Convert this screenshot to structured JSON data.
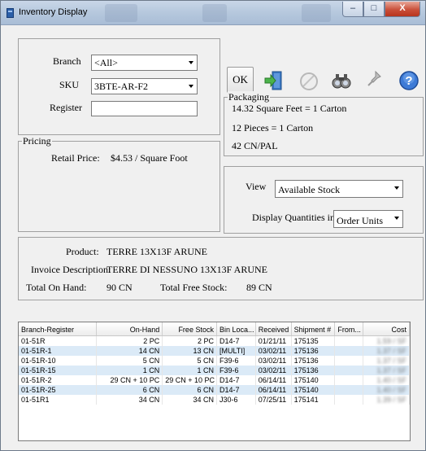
{
  "window": {
    "title": "Inventory Display"
  },
  "filters": {
    "branch_label": "Branch",
    "branch_value": "<All>",
    "sku_label": "SKU",
    "sku_value": "3BTE-AR-F2",
    "register_label": "Register",
    "register_value": ""
  },
  "toolbar": {
    "ok_label": "OK"
  },
  "packaging": {
    "legend": "Packaging",
    "lines": [
      "14.32 Square Feet = 1 Carton",
      "12 Pieces = 1 Carton",
      "42 CN/PAL"
    ]
  },
  "pricing": {
    "legend": "Pricing",
    "retail_label": "Retail Price:",
    "retail_value": "$4.53 / Square Foot"
  },
  "view": {
    "view_label": "View",
    "view_value": "Available Stock",
    "display_label": "Display Quantities in",
    "display_value": "Order Units"
  },
  "product": {
    "product_label": "Product:",
    "product_value": "TERRE 13X13F    ARUNE",
    "invoice_label": "Invoice Description:",
    "invoice_value": "TERRE DI NESSUNO 13X13F ARUNE",
    "onhand_label": "Total On Hand:",
    "onhand_value": "90 CN",
    "free_label": "Total Free Stock:",
    "free_value": "89 CN"
  },
  "grid": {
    "columns": [
      "Branch-Register",
      "On-Hand",
      "Free Stock",
      "Bin Loca...",
      "Received",
      "Shipment #",
      "From...",
      "Cost"
    ],
    "rows": [
      [
        "01-51R",
        "2 PC",
        "2 PC",
        "D14-7",
        "01/21/11",
        "175135",
        "",
        "1.59 / SF"
      ],
      [
        "01-51R-1",
        "14 CN",
        "13 CN",
        "[MULTI]",
        "03/02/11",
        "175136",
        "",
        "1.37 / SF"
      ],
      [
        "01-51R-10",
        "5 CN",
        "5 CN",
        "F39-6",
        "03/02/11",
        "175136",
        "",
        "1.37 / SF"
      ],
      [
        "01-51R-15",
        "1 CN",
        "1 CN",
        "F39-6",
        "03/02/11",
        "175136",
        "",
        "1.37 / SF"
      ],
      [
        "01-51R-2",
        "29 CN + 10 PC",
        "29 CN + 10 PC",
        "D14-7",
        "06/14/11",
        "175140",
        "",
        "1.40 / SF"
      ],
      [
        "01-51R-25",
        "6 CN",
        "6 CN",
        "D14-7",
        "06/14/11",
        "175140",
        "",
        "1.40 / SF"
      ],
      [
        "01-51R1",
        "34 CN",
        "34 CN",
        "J30-6",
        "07/25/11",
        "175141",
        "",
        "1.39 / SF"
      ]
    ]
  },
  "colors": {
    "titlebar": "#b7c9de",
    "row_alt": "#dbeaf7",
    "close_button": "#c9503a"
  }
}
